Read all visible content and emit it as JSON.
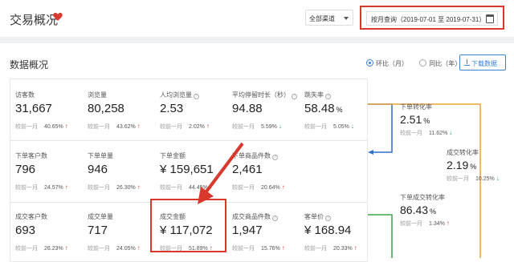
{
  "header": {
    "title": "交易概况",
    "channel_select": "全部渠道",
    "date_range": "按月查询（2019-07-01 至 2019-07-31）"
  },
  "section": {
    "title": "数据概况",
    "compare_options": [
      "环比（月）",
      "同比（年）"
    ],
    "download_label": "下载数据"
  },
  "metrics": {
    "visitors": {
      "label": "访客数",
      "value": "31,667",
      "cmp_label": "较前一月",
      "cmp": "40.65%",
      "dir": "up"
    },
    "pageviews": {
      "label": "浏览量",
      "value": "80,258",
      "cmp_label": "较前一月",
      "cmp": "43.62%",
      "dir": "up"
    },
    "pv_per_visitor": {
      "label": "人均浏览量",
      "value": "2.53",
      "cmp_label": "较前一月",
      "cmp": "2.02%",
      "dir": "up"
    },
    "avg_stay": {
      "label": "平均停留时长（秒）",
      "value": "94.88",
      "cmp_label": "较前一月",
      "cmp": "5.59%",
      "dir": "down"
    },
    "bounce": {
      "label": "跳失率",
      "value": "58.48",
      "unit": "%",
      "cmp_label": "较前一月",
      "cmp": "5.05%",
      "dir": "down"
    },
    "order_customers": {
      "label": "下单客户数",
      "value": "796",
      "cmp_label": "较前一月",
      "cmp": "24.57%",
      "dir": "up"
    },
    "order_count": {
      "label": "下单单量",
      "value": "946",
      "cmp_label": "较前一月",
      "cmp": "26.30%",
      "dir": "up"
    },
    "order_amount": {
      "label": "下单金额",
      "value": "¥ 159,651",
      "cmp_label": "较前一月",
      "cmp": "44.45%",
      "dir": "up"
    },
    "order_items": {
      "label": "下单商品件数",
      "value": "2,461",
      "cmp_label": "较前一月",
      "cmp": "20.64%",
      "dir": "up"
    },
    "deal_customers": {
      "label": "成交客户数",
      "value": "693",
      "cmp_label": "较前一月",
      "cmp": "26.23%",
      "dir": "up"
    },
    "deal_count": {
      "label": "成交单量",
      "value": "717",
      "cmp_label": "较前一月",
      "cmp": "24.05%",
      "dir": "up"
    },
    "deal_amount": {
      "label": "成交金额",
      "value": "¥ 117,072",
      "cmp_label": "较前一月",
      "cmp": "51.89%",
      "dir": "up"
    },
    "deal_items": {
      "label": "成交商品件数",
      "value": "1,947",
      "cmp_label": "较前一月",
      "cmp": "15.76%",
      "dir": "up"
    },
    "unit_price": {
      "label": "客单价",
      "value": "¥ 168.94",
      "cmp_label": "较前一月",
      "cmp": "20.33%",
      "dir": "up"
    }
  },
  "funnel": {
    "order_conv": {
      "label": "下单转化率",
      "value": "2.51",
      "unit": "%",
      "cmp_label": "较前一月",
      "cmp": "11.62%",
      "dir": "down"
    },
    "deal_conv": {
      "label": "成交转化率",
      "value": "2.19",
      "unit": "%",
      "cmp_label": "较前一月",
      "cmp": "10.25%",
      "dir": "down"
    },
    "order_deal_conv": {
      "label": "下单成交转化率",
      "value": "86.43",
      "unit": "%",
      "cmp_label": "较前一月",
      "cmp": "1.34%",
      "dir": "up"
    }
  },
  "colors": {
    "accent": "#3b82d6",
    "highlight": "#d9382c",
    "up": "#d9382c",
    "down": "#2aa86a",
    "line_blue": "#2f6fc7",
    "line_green": "#3aa64a",
    "line_orange": "#e8a23a"
  }
}
